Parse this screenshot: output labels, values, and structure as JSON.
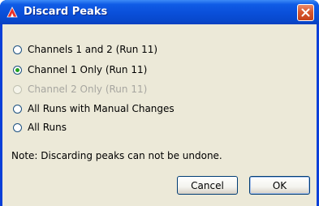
{
  "window": {
    "title": "Discard Peaks",
    "icon": "app-logo-icon",
    "close_icon": "close-icon"
  },
  "options": [
    {
      "label": "Channels 1 and 2 (Run 11)",
      "checked": false,
      "disabled": false
    },
    {
      "label": "Channel 1 Only (Run 11)",
      "checked": true,
      "disabled": false
    },
    {
      "label": "Channel 2 Only (Run 11)",
      "checked": false,
      "disabled": true
    },
    {
      "label": "All Runs with Manual Changes",
      "checked": false,
      "disabled": false
    },
    {
      "label": "All Runs",
      "checked": false,
      "disabled": false
    }
  ],
  "note": "Note: Discarding peaks can not be undone.",
  "buttons": {
    "cancel": "Cancel",
    "ok": "OK"
  },
  "colors": {
    "titlebar": "#0a4fd9",
    "client_bg": "#ece9d8",
    "close_button": "#d8572f",
    "radio_dot": "#21a121"
  }
}
